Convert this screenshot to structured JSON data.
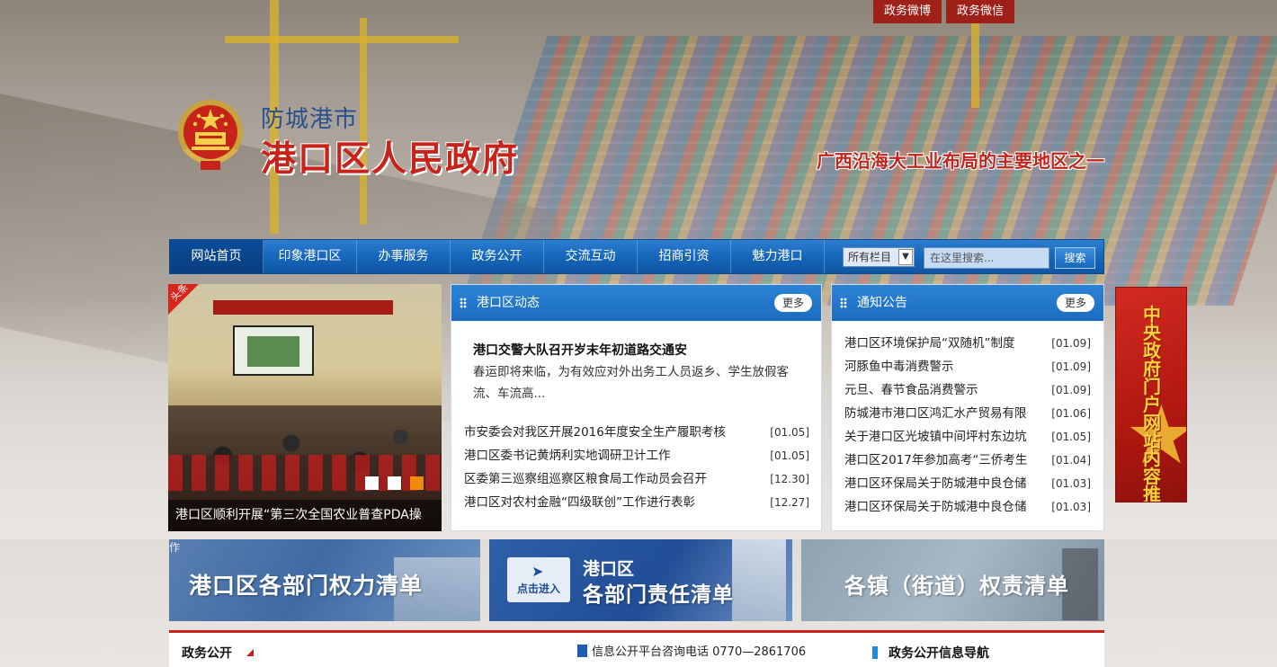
{
  "top_links": {
    "weibo": "政务微博",
    "weixin": "政务微信"
  },
  "logo": {
    "city": "防城港市",
    "gov": "港口区人民政府"
  },
  "slogan": "广西沿海大工业布局的主要地区之一",
  "nav": {
    "items": [
      "网站首页",
      "印象港口区",
      "办事服务",
      "政务公开",
      "交流互动",
      "招商引资",
      "魅力港口"
    ],
    "active_index": 0,
    "search_scope": "所有栏目",
    "search_placeholder": "在这里搜索...",
    "search_button": "搜索"
  },
  "slide": {
    "tag": "头条",
    "caption": "港口区顺利开展“第三次全国农业普查PDA操",
    "active_dot": 3
  },
  "news": {
    "title": "港口区动态",
    "more": "更多",
    "lead_title": "港口交警大队召开岁末年初道路交通安",
    "lead_body": "春运即将来临，为有效应对外出务工人员返乡、学生放假客流、车流高...",
    "items": [
      {
        "title": "市安委会对我区开展2016年度安全生产履职考核",
        "date": "[01.05]"
      },
      {
        "title": "港口区委书记黄炳利实地调研卫计工作",
        "date": "[01.05]"
      },
      {
        "title": "区委第三巡察组巡察区粮食局工作动员会召开",
        "date": "[12.30]"
      },
      {
        "title": "港口区对农村金融“四级联创”工作进行表彰",
        "date": "[12.27]"
      }
    ]
  },
  "notice": {
    "title": "通知公告",
    "more": "更多",
    "items": [
      {
        "title": "港口区环境保护局“双随机”制度",
        "date": "[01.09]"
      },
      {
        "title": "河豚鱼中毒消费警示",
        "date": "[01.09]"
      },
      {
        "title": "元旦、春节食品消费警示",
        "date": "[01.09]"
      },
      {
        "title": "防城港市港口区鸿汇水产贸易有限",
        "date": "[01.06]"
      },
      {
        "title": "关于港口区光坡镇中间坪村东边坑",
        "date": "[01.05]"
      },
      {
        "title": "港口区2017年参加高考“三侨考生",
        "date": "[01.04]"
      },
      {
        "title": "港口区环保局关于防城港中良仓储",
        "date": "[01.03]"
      },
      {
        "title": "港口区环保局关于防城港中良仓储",
        "date": "[01.03]"
      }
    ]
  },
  "side_banner": "中央政府门户网站内容推荐",
  "tiles": {
    "t1_cut": "作",
    "t1": "港口区各部门权力清单",
    "t2_button": "点击进入",
    "t2_small": "港口区",
    "t2": "各部门责任清单",
    "t3": "各镇（街道）权责清单"
  },
  "bottom": {
    "section": "政务公开",
    "phone": "信息公开平台咨询电话 0770—2861706",
    "guide": "政务公开信息导航"
  },
  "colors": {
    "brand_red": "#c8231a",
    "nav_blue": "#1565b8",
    "accent_orange": "#f08a0c"
  }
}
